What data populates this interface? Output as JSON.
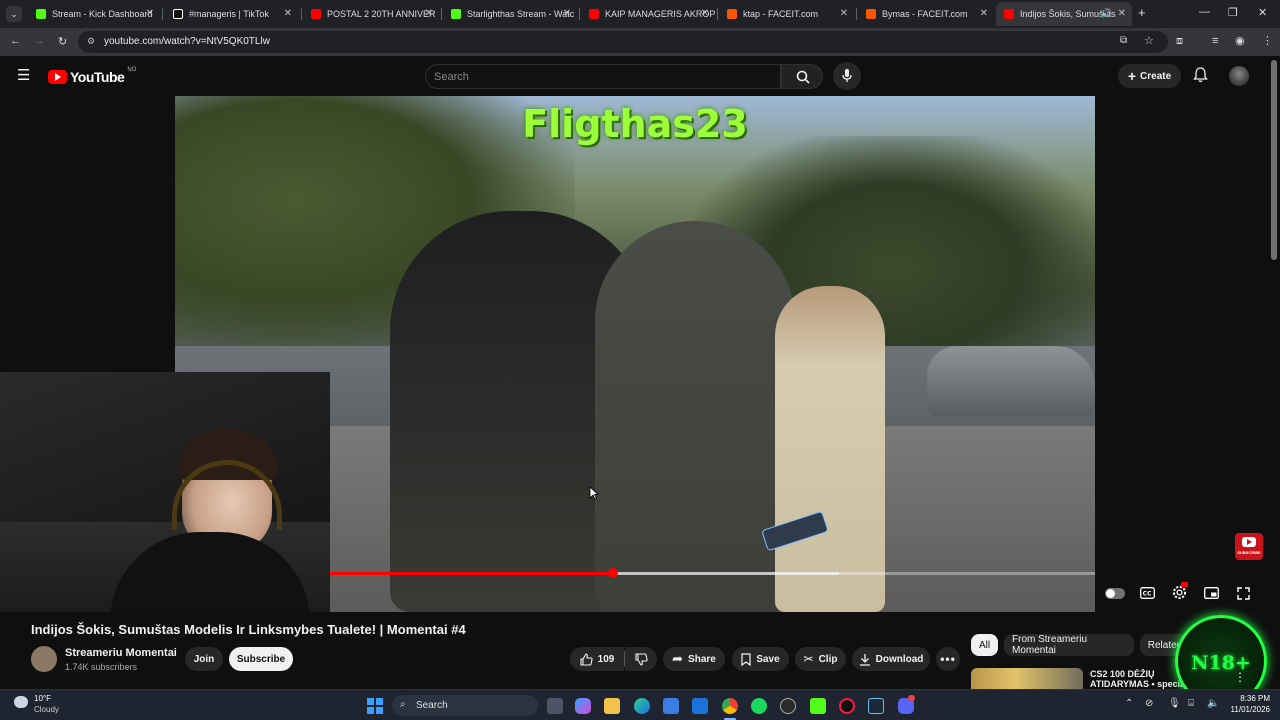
{
  "browser": {
    "tabs": [
      {
        "title": "Stream - Kick Dashboard",
        "icon": "kick-icon",
        "color": "#53fc18"
      },
      {
        "title": "#manageris | TikTok",
        "icon": "tiktok-icon",
        "color": "#ffffff"
      },
      {
        "title": "POSTAL 2 20TH ANNIVER",
        "icon": "youtube-icon",
        "color": "#ff0000"
      },
      {
        "title": "Starlighthas Stream - Watc",
        "icon": "kick-icon",
        "color": "#53fc18"
      },
      {
        "title": "KAIP MANAGERIS AKROP",
        "icon": "youtube-icon",
        "color": "#ff0000"
      },
      {
        "title": "ktap - FACEIT.com",
        "icon": "faceit-icon",
        "color": "#ff5500"
      },
      {
        "title": "Bymas - FACEIT.com",
        "icon": "faceit-icon",
        "color": "#ff5500"
      },
      {
        "title": "Indijos Šokis, Sumuštas",
        "icon": "youtube-icon",
        "color": "#ff0000"
      }
    ],
    "url": "youtube.com/watch?v=NtV5QK0TLlw"
  },
  "youtube": {
    "logo_text": "YouTube",
    "region": "NO",
    "search_placeholder": "Search",
    "create_label": "Create"
  },
  "video": {
    "overlay_text": "Fligthas23",
    "progress": 0.37,
    "title": "Indijos Šokis, Sumuštas Modelis Ir Linksmybes Tualete! | Momentai #4",
    "subscribe_badge": "SUBSCRIBE"
  },
  "channel": {
    "name": "Streameriu Momentai",
    "subscribers": "1.74K subscribers",
    "join_label": "Join",
    "subscribe_label": "Subscribe"
  },
  "actions": {
    "likes": "109",
    "share": "Share",
    "save": "Save",
    "clip": "Clip",
    "download": "Download"
  },
  "chips": [
    "All",
    "From Streameriu Momentai",
    "Related"
  ],
  "sidebar_preview": {
    "text": "CS2 100 DĖŽIŲ ATIDARYMAS • special"
  },
  "badge": {
    "text": "N18+"
  },
  "taskbar": {
    "weather_temp": "10°F",
    "weather_desc": "Cloudy",
    "search_label": "Search",
    "time": "8:36 PM",
    "date": "11/01/2026"
  },
  "colors": {
    "accent_red": "#ff0000",
    "overlay_green": "#9cff3a",
    "badge_green": "#22ff44"
  }
}
